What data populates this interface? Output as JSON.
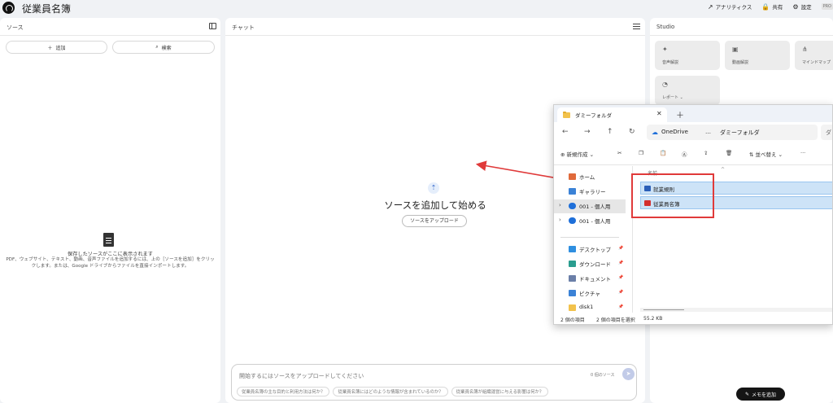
{
  "app": {
    "title": "従業員名簿",
    "actions": [
      {
        "icon": "analytics-icon",
        "label": "アナリティクス"
      },
      {
        "icon": "share-icon",
        "label": "共有"
      },
      {
        "icon": "settings-icon",
        "label": "設定"
      }
    ],
    "plan_badge": "PRO"
  },
  "sources": {
    "title": "ソース",
    "add_label": "追加",
    "search_label": "検索",
    "empty_title": "保存したソースがここに表示されます",
    "empty_desc": "PDF、ウェブサイト、テキスト、動画、音声ファイルを追加するには、上の［ソースを追加］をクリックします。または、Google ドライブからファイルを直接インポートします。"
  },
  "chat": {
    "title": "チャット",
    "heading": "ソースを追加して始める",
    "upload_label": "ソースをアップロード",
    "input_placeholder": "開始するにはソースをアップロードしてください",
    "source_count": "0 個のソース",
    "suggestions": [
      "従業員名簿の主な目的と利用方法は何か？",
      "従業員名簿にはどのような情報が含まれているのか？",
      "従業員名簿が組織運営に与える影響は何か？"
    ]
  },
  "studio": {
    "title": "Studio",
    "cards": [
      {
        "icon": "sparkle-icon",
        "label": "音声解説"
      },
      {
        "icon": "video-icon",
        "label": "動画解説"
      },
      {
        "icon": "mindmap-icon",
        "label": "マインドマップ"
      },
      {
        "icon": "report-icon",
        "label": "レポート"
      }
    ],
    "memo_label": "メモを追加"
  },
  "explorer": {
    "tab_title": "ダミーフォルダ",
    "breadcrumb": [
      "OneDrive",
      "…",
      "ダミーフォルダ"
    ],
    "search_hint": "ダ",
    "toolbar": {
      "new_label": "新規作成",
      "sort_label": "並べ替え"
    },
    "nav_items": [
      {
        "label": "ホーム",
        "color": "#e06a3b",
        "pin": false
      },
      {
        "label": "ギャラリー",
        "color": "#3b82d6",
        "pin": false
      },
      {
        "label": "001 - 個人用",
        "color": "#1e6fd9",
        "pin": false
      },
      {
        "label": "001 - 個人用",
        "color": "#1e6fd9",
        "pin": false
      },
      {
        "label": "デスクトップ",
        "color": "#2f8fe0",
        "pin": true
      },
      {
        "label": "ダウンロード",
        "color": "#2a9d8f",
        "pin": true
      },
      {
        "label": "ドキュメント",
        "color": "#6b7fa8",
        "pin": true
      },
      {
        "label": "ピクチャ",
        "color": "#3b82d6",
        "pin": true
      },
      {
        "label": "disk1",
        "color": "#f2c24c",
        "pin": true
      }
    ],
    "column_header": "名前",
    "files": [
      {
        "name": "就業規則",
        "icon": "word-doc-icon",
        "color": "#2b5fb8"
      },
      {
        "name": "従業員名簿",
        "icon": "pdf-icon",
        "color": "#d32f2f"
      }
    ],
    "status": {
      "count": "2 個の項目",
      "selected": "2 個の項目を選択",
      "size": "55.2 KB"
    }
  }
}
